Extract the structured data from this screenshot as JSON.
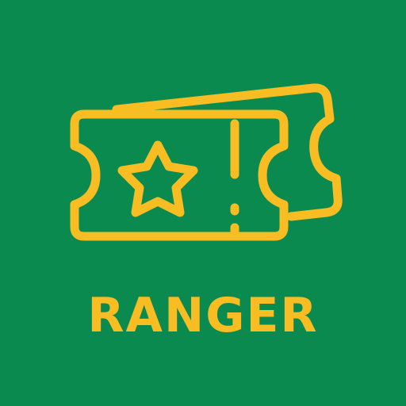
{
  "icon": {
    "name": "ticket-icon",
    "star_name": "star-icon"
  },
  "label": "RANGER",
  "colors": {
    "background": "#0b8a50",
    "accent": "#f7bd22"
  }
}
